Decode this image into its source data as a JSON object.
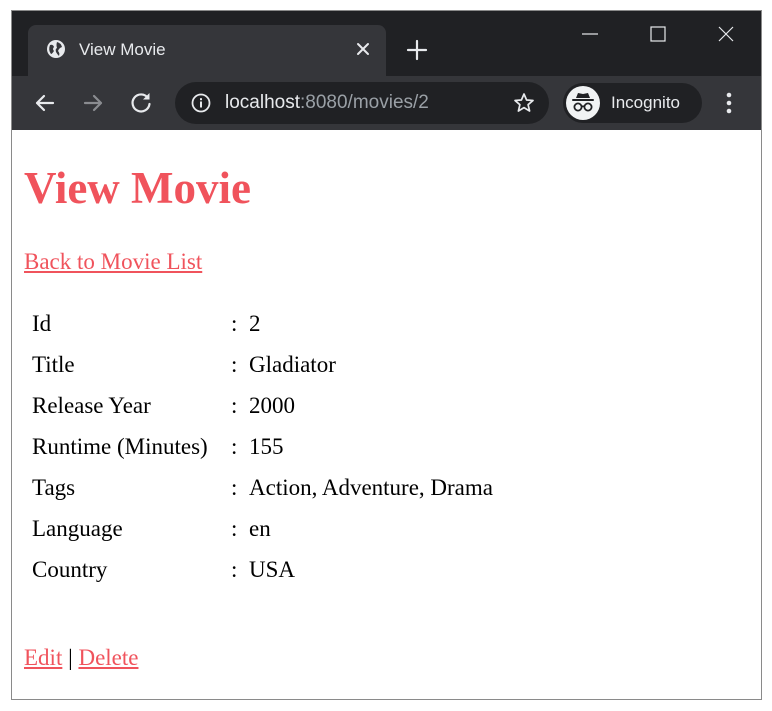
{
  "browser": {
    "tab": {
      "title": "View Movie",
      "favicon_icon": "globe-icon",
      "close_icon": "close-icon"
    },
    "new_tab_icon": "plus-icon",
    "window_controls": {
      "minimize_icon": "minimize-icon",
      "maximize_icon": "maximize-icon",
      "close_icon": "close-icon"
    },
    "toolbar": {
      "back_icon": "arrow-left-icon",
      "forward_icon": "arrow-right-icon",
      "reload_icon": "reload-icon",
      "site_info_icon": "info-icon",
      "url_host": "localhost",
      "url_path": ":8080/movies/2",
      "bookmark_icon": "star-icon",
      "profile_label": "Incognito",
      "profile_icon": "incognito-icon",
      "menu_icon": "kebab-menu-icon"
    },
    "colors": {
      "tabstrip_bg": "#202124",
      "toolbar_bg": "#35363a",
      "accent": "#f0535c"
    }
  },
  "page": {
    "title": "View Movie",
    "back_link": "Back to Movie List",
    "separator": ":",
    "fields": [
      {
        "label": "Id",
        "value": "2"
      },
      {
        "label": "Title",
        "value": "Gladiator"
      },
      {
        "label": "Release Year",
        "value": "2000"
      },
      {
        "label": "Runtime (Minutes)",
        "value": "155"
      },
      {
        "label": "Tags",
        "value": "Action, Adventure, Drama"
      },
      {
        "label": "Language",
        "value": "en"
      },
      {
        "label": "Country",
        "value": "USA"
      }
    ],
    "actions": {
      "edit": "Edit",
      "divider": "|",
      "delete": "Delete"
    }
  }
}
